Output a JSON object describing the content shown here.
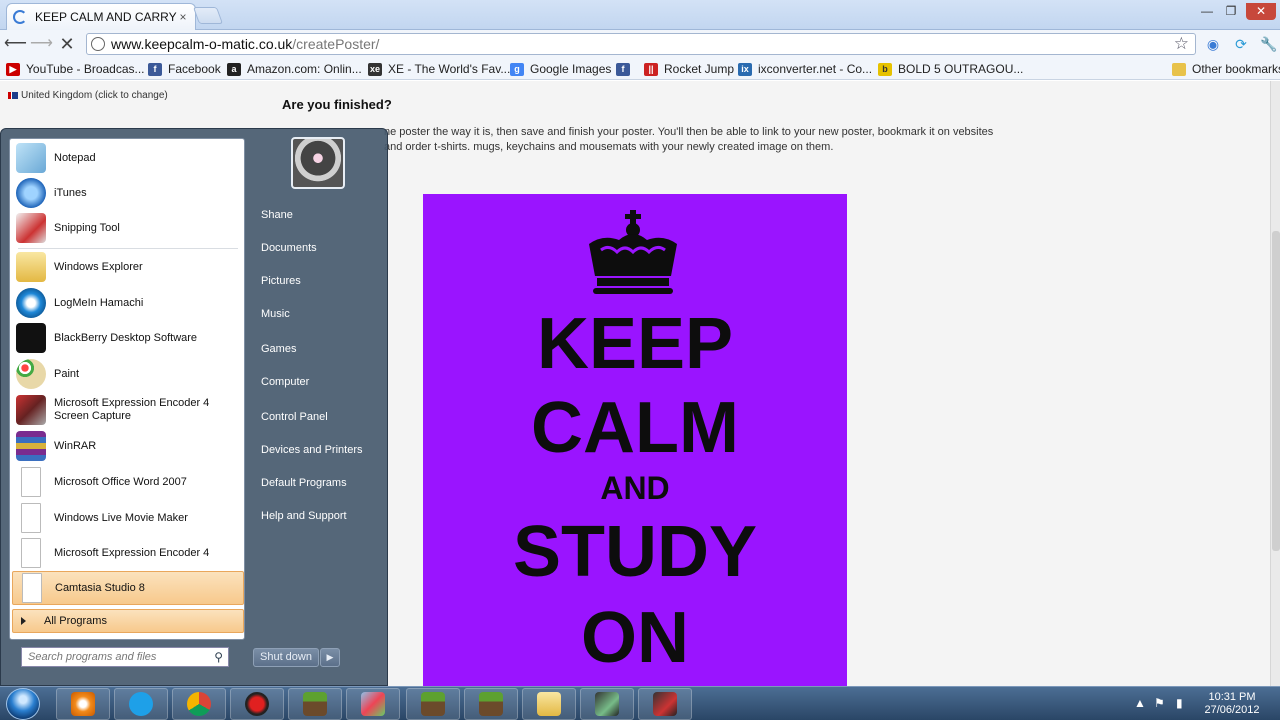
{
  "browser": {
    "tab_title": "KEEP CALM AND CARRY ON",
    "tab_close": "×",
    "url_domain": "www.keepcalm-o-matic.co.uk",
    "url_path": "/createPoster/",
    "window_controls": [
      "—",
      "❐",
      "✕"
    ],
    "bookmarks": [
      {
        "label": "YouTube - Broadcas...",
        "color": "#cc0000"
      },
      {
        "label": "Facebook",
        "color": "#3b5998"
      },
      {
        "label": "Amazon.com: Onlin...",
        "color": "#222222"
      },
      {
        "label": "XE - The World's Fav...",
        "color": "#333333"
      },
      {
        "label": "Google Images",
        "color": "#4285f4"
      },
      {
        "label": "",
        "color": "#3b5998"
      },
      {
        "label": "Rocket Jump",
        "color": "#cc2222"
      },
      {
        "label": "ixconverter.net - Co...",
        "color": "#2a6bb0"
      },
      {
        "label": "BOLD 5 OUTRAGOU...",
        "color": "#e6c200"
      }
    ],
    "other_bookmarks": "Other bookmarks"
  },
  "page": {
    "country": "United Kingdom (click to change)",
    "heading": "Are you finished?",
    "intro": "ne poster the way it is, then save and finish your poster. You'll then be able to link to your new poster, bookmark it on vebsites and order t-shirts. mugs, keychains and mousemats with your newly created image on them.",
    "poster": {
      "background": "#9a14ff",
      "lines": [
        "KEEP",
        "CALM",
        "AND",
        "STUDY",
        "ON"
      ]
    }
  },
  "startmenu": {
    "programs": [
      {
        "label": "Notepad",
        "icon": "notepad-icon"
      },
      {
        "label": "iTunes",
        "icon": "itunes-icon"
      },
      {
        "label": "Snipping Tool",
        "icon": "scissors-icon"
      },
      {
        "label": "Windows Explorer",
        "icon": "folder-icon"
      },
      {
        "label": "LogMeIn Hamachi",
        "icon": "hamachi-icon"
      },
      {
        "label": "BlackBerry Desktop Software",
        "icon": "blackberry-icon"
      },
      {
        "label": "Paint",
        "icon": "palette-icon"
      },
      {
        "label": "Microsoft Expression Encoder 4 Screen Capture",
        "icon": "encoder-capture-icon"
      },
      {
        "label": "WinRAR",
        "icon": "winrar-icon"
      },
      {
        "label": "Microsoft Office Word 2007",
        "icon": "document-icon"
      },
      {
        "label": "Windows Live Movie Maker",
        "icon": "document-icon"
      },
      {
        "label": "Microsoft Expression Encoder 4",
        "icon": "document-icon"
      },
      {
        "label": "Camtasia Studio 8",
        "icon": "document-icon"
      }
    ],
    "all_programs": "All Programs",
    "search_placeholder": "Search programs and files",
    "places": [
      "Shane",
      "Documents",
      "Pictures",
      "Music",
      "Games",
      "Computer",
      "Control Panel",
      "Devices and Printers",
      "Default Programs",
      "Help and Support"
    ],
    "shutdown": "Shut down",
    "shutdown_arrow": "▶"
  },
  "taskbar": {
    "apps": [
      "media-player-icon",
      "skype-icon",
      "chrome-icon",
      "app-red-icon",
      "minecraft-icon",
      "network-icon",
      "minecraft-icon",
      "minecraft-icon",
      "folder-icon",
      "camtasia-icon",
      "camtasia-recorder-icon"
    ],
    "time": "10:31 PM",
    "date": "27/06/2012"
  }
}
